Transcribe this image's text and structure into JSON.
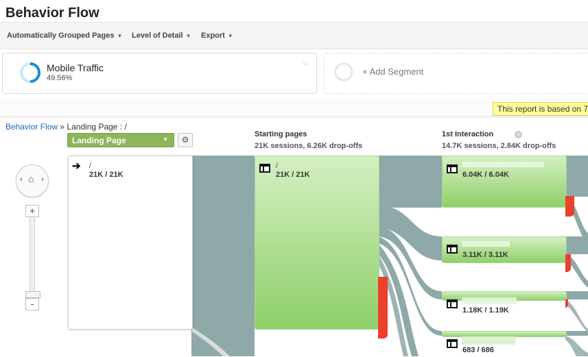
{
  "header": {
    "title": "Behavior Flow"
  },
  "toolbar": {
    "items": [
      "Automatically Grouped Pages",
      "Level of Detail",
      "Export"
    ]
  },
  "segments": {
    "active": {
      "name": "Mobile Traffic",
      "percent": "49.56%",
      "ring_fraction": 0.4956,
      "color": "#1a8bd9"
    },
    "add_label": "+ Add Segment"
  },
  "sampling_note": "This report is based on 7",
  "breadcrumb": {
    "link": "Behavior Flow",
    "separator": "»",
    "current": "Landing Page : /"
  },
  "dimension_select": {
    "value": "Landing Page"
  },
  "columns": {
    "starting": {
      "title": "Starting pages",
      "stats": "21K sessions, 6.26K drop-offs"
    },
    "first": {
      "title": "1st Interaction",
      "stats": "14.7K sessions, 2.84K drop-offs"
    }
  },
  "landing_node": {
    "page": "/",
    "value": "21K / 21K"
  },
  "starting_node": {
    "page": "/",
    "value": "21K / 21K"
  },
  "interaction_nodes": [
    {
      "value": "6.04K / 6.04K"
    },
    {
      "value": "3.11K / 3.11K"
    },
    {
      "value": "1.18K / 1.19K"
    },
    {
      "value": "683 / 686"
    }
  ],
  "zoom": {
    "plus": "+",
    "minus": "-"
  },
  "colors": {
    "flow": "#8fa8a8",
    "node_green": "#8fd06a",
    "dropoff": "#e8412c",
    "select_green": "#8eb55b"
  }
}
